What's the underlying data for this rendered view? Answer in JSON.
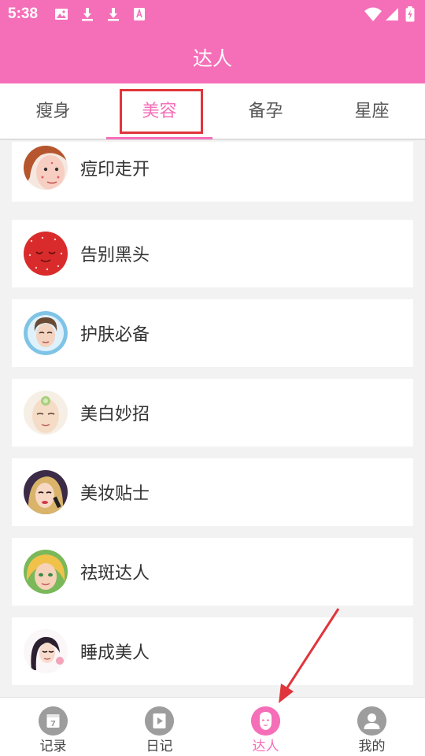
{
  "status_bar": {
    "time": "5:38",
    "icons": [
      "image-icon",
      "download-icon",
      "download-icon",
      "text-a-icon",
      "wifi-icon",
      "signal-icon",
      "battery-charging-icon"
    ]
  },
  "header": {
    "title": "达人"
  },
  "tabs": [
    {
      "label": "瘦身",
      "active": false
    },
    {
      "label": "美容",
      "active": true
    },
    {
      "label": "备孕",
      "active": false
    },
    {
      "label": "星座",
      "active": false
    }
  ],
  "list": {
    "items": [
      {
        "label": "痘印走开",
        "icon": "acne-face-avatar"
      },
      {
        "label": "告别黑头",
        "icon": "strawberry-avatar"
      },
      {
        "label": "护肤必备",
        "icon": "skincare-face-avatar"
      },
      {
        "label": "美白妙招",
        "icon": "face-mask-avatar"
      },
      {
        "label": "美妆贴士",
        "icon": "makeup-avatar"
      },
      {
        "label": "祛斑达人",
        "icon": "blonde-woman-avatar"
      },
      {
        "label": "睡成美人",
        "icon": "sleeping-woman-avatar"
      }
    ]
  },
  "bottom_nav": {
    "items": [
      {
        "label": "记录",
        "icon": "calendar-icon",
        "active": false
      },
      {
        "label": "日记",
        "icon": "play-book-icon",
        "active": false
      },
      {
        "label": "达人",
        "icon": "face-icon",
        "active": true
      },
      {
        "label": "我的",
        "icon": "person-icon",
        "active": false
      }
    ]
  },
  "colors": {
    "brand_pink": "#f56fb8",
    "annotation_red": "#e0353c",
    "nav_gray": "#9d9d9d"
  }
}
